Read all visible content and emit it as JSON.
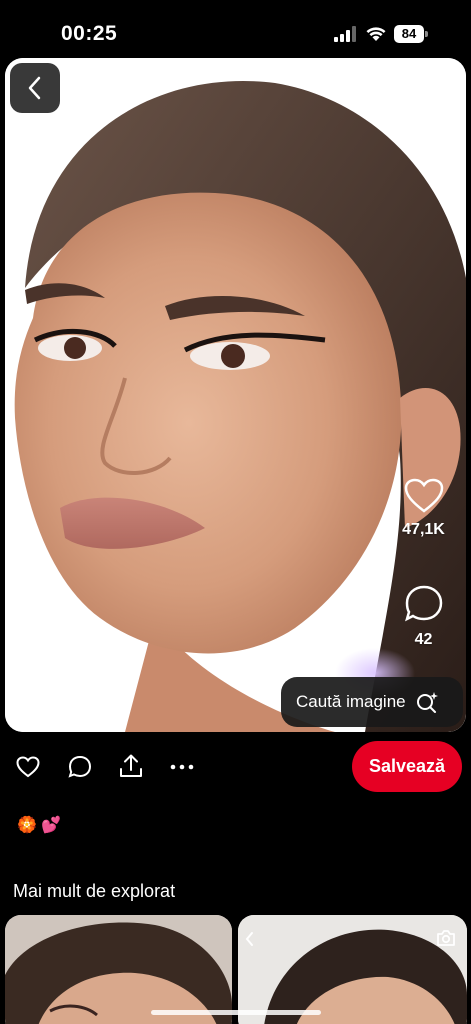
{
  "status_bar": {
    "time": "00:25",
    "battery": "84"
  },
  "pin": {
    "likes_count": "47,1K",
    "comments_count": "42",
    "search_image_label": "Caută imagine"
  },
  "actions": {
    "save_label": "Salvează"
  },
  "description": {
    "emojis": "🏵️ 💕"
  },
  "more_to_explore": {
    "title": "Mai mult de explorat"
  },
  "colors": {
    "save_red": "#e60023",
    "background": "#000000"
  },
  "icons": [
    "back-chevron-icon",
    "heart-icon",
    "comment-icon",
    "share-icon",
    "more-icon",
    "visual-search-icon",
    "camera-icon"
  ]
}
